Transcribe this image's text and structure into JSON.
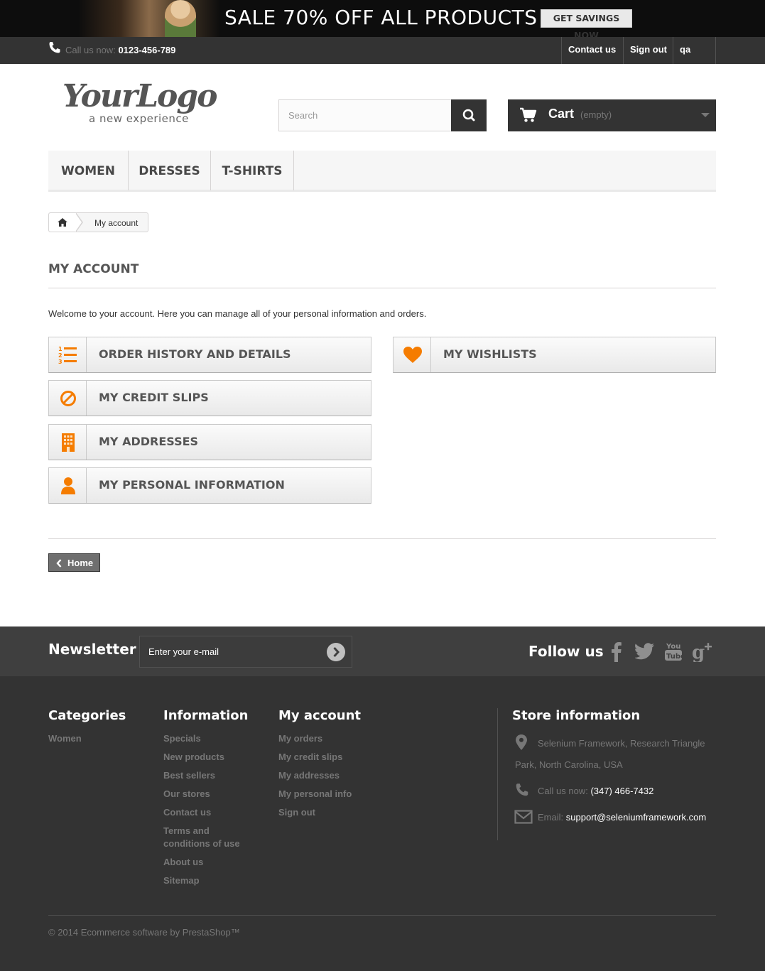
{
  "banner": {
    "text": "SALE 70% OFF ALL PRODUCTS",
    "button": "GET SAVINGS NOW"
  },
  "topbar": {
    "call_label": "Call us now:",
    "phone": "0123-456-789",
    "links": [
      "Contact us",
      "Sign out",
      "qa test"
    ]
  },
  "header": {
    "logo_script": "YourLogo",
    "logo_sub": "a new experience",
    "search_placeholder": "Search",
    "cart_label": "Cart",
    "cart_status": "(empty)"
  },
  "menu": [
    "WOMEN",
    "DRESSES",
    "T-SHIRTS"
  ],
  "breadcrumb": {
    "current": "My account"
  },
  "page": {
    "title": "MY ACCOUNT",
    "welcome": "Welcome to your account. Here you can manage all of your personal information and orders.",
    "buttons_left": [
      "ORDER HISTORY AND DETAILS",
      "MY CREDIT SLIPS",
      "MY ADDRESSES",
      "MY PERSONAL INFORMATION"
    ],
    "buttons_right": [
      "MY WISHLISTS"
    ],
    "home_button": "Home",
    "icons": [
      "list-ol-icon",
      "ban-icon",
      "building-icon",
      "user-icon",
      "heart-icon"
    ],
    "accent_color": "#f57c00"
  },
  "newsletter": {
    "title": "Newsletter",
    "input_value": "Enter your e-mail",
    "follow_title": "Follow us",
    "social_icons": [
      "facebook-icon",
      "twitter-icon",
      "youtube-icon",
      "google-plus-icon"
    ]
  },
  "footer": {
    "categories": {
      "title": "Categories",
      "links": [
        "Women"
      ]
    },
    "information": {
      "title": "Information",
      "links": [
        "Specials",
        "New products",
        "Best sellers",
        "Our stores",
        "Contact us",
        "Terms and conditions of use",
        "About us",
        "Sitemap"
      ]
    },
    "my_account": {
      "title": "My account",
      "links": [
        "My orders",
        "My credit slips",
        "My addresses",
        "My personal info",
        "Sign out"
      ]
    },
    "store": {
      "title": "Store information",
      "address_1": "Selenium Framework, Research Triangle",
      "address_2": "Park, North Carolina, USA",
      "call_label": "Call us now:",
      "phone": "(347) 466-7432",
      "email_label": "Email:",
      "email": "support@seleniumframework.com"
    },
    "copyright": "© 2014 Ecommerce software by PrestaShop™"
  }
}
